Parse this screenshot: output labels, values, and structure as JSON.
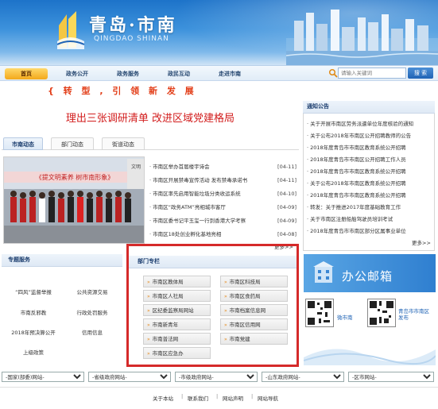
{
  "header": {
    "logo_cn": "青岛·市南",
    "logo_en": "QINGDAO SHINAN"
  },
  "nav": {
    "items": [
      {
        "label": "首页",
        "active": true
      },
      {
        "label": "政务公开",
        "active": false
      },
      {
        "label": "政务服务",
        "active": false
      },
      {
        "label": "政民互动",
        "active": false
      },
      {
        "label": "走进市南",
        "active": false
      }
    ],
    "search_placeholder": "请输入关键词",
    "search_button": "搜 索"
  },
  "slogan": "{ 转 型 , 引 领 新 发 展",
  "headline": "理出三张调研清单 改进区域党建格局",
  "news_tabs": [
    "市南动态",
    "部门动态",
    "街道动态"
  ],
  "news_photo": {
    "banner_text": "《提文明素养 树市南形象》",
    "side_text": "文明"
  },
  "news": [
    {
      "title": "· 市南区举办首届楼宇诗会",
      "date": "[04-11]"
    },
    {
      "title": "· 市南区开展禁毒宣传活动 发布禁毒承诺书",
      "date": "[04-11]"
    },
    {
      "title": "· 市南区率先启用智能垃圾分类收运系统",
      "date": "[04-10]"
    },
    {
      "title": "· 市南区“政务ATM”亮相城市客厅",
      "date": "[04-09]"
    },
    {
      "title": "· 市南区委书记平玉玺一行到香港大学考察",
      "date": "[04-09]"
    },
    {
      "title": "· 市南区18处创业孵化基地亮相",
      "date": "[04-08]"
    }
  ],
  "news_more": "更多>>",
  "notices": {
    "title": "通知公告",
    "items": [
      "· 关于开展市南区劳务派遣单位年度核验的通知",
      "· 关于公布2018年市南区公开招聘教师的公告",
      "· 2018年度青岛市市南区教育系统公开招聘",
      "· 2018年度青岛市市南区公开招聘工作人员",
      "· 2018年度青岛市市南区教育系统公开招聘",
      "· 关于公布2018年市南区教育系统公开招聘",
      "· 2018年度青岛市市南区教育系统公开招聘",
      "· 转发：关于推进2017年度基础教育工作",
      "· 关于市南区注册船舶驾驶员培训考试",
      "· 2018年度青岛市市南区部分区属事业单位"
    ],
    "more": "更多>>"
  },
  "special_services": {
    "title": "专题服务",
    "items": [
      "“四风”监督举报",
      "公共资源交易",
      "市南反邪教",
      "行政处罚服务",
      "2018年预决算公开",
      "信用信息",
      "上级政策"
    ]
  },
  "department": {
    "title": "部门专栏",
    "items": [
      "市南区教体局",
      "市南区科技局",
      "市南区人社局",
      "市南区食药局",
      "区纪委监察局网站",
      "市南档案信息网",
      "市南新青年",
      "市南区信用网",
      "市南普法网",
      "市南党建",
      "市南区应急办"
    ]
  },
  "mail": {
    "text": "办公邮箱",
    "qr1_label": "微市南",
    "qr2_label": "青岛市市南区发布"
  },
  "site_selects": [
    "-国家(部委)网站-",
    "-省级政府网站-",
    "-市级政府网站-",
    "-山东政府网站-",
    "-区市网站-"
  ],
  "footer": {
    "links": [
      "关于本站",
      "联系我们",
      "网站声明",
      "网站导航"
    ]
  },
  "colors": {
    "brand_blue": "#1f63b5",
    "headline_red": "#d21c1c",
    "highlight_box": "#d52a2a",
    "nav_active": "#f3a81b"
  }
}
